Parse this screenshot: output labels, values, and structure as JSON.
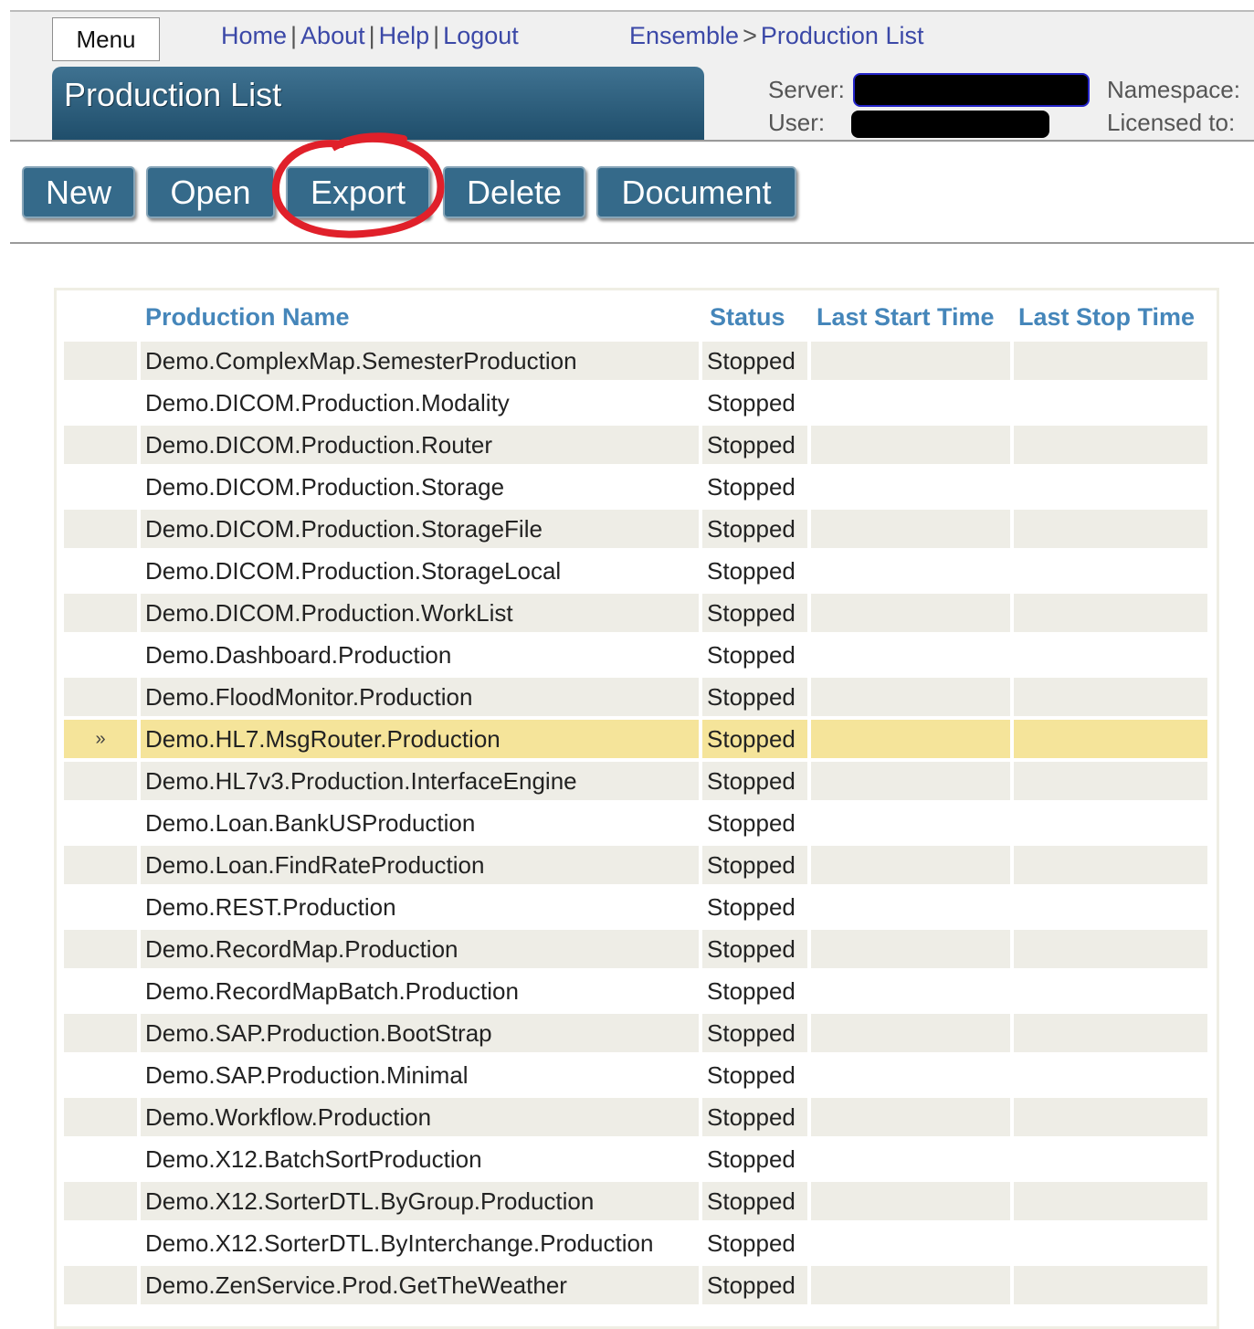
{
  "header": {
    "menu_label": "Menu",
    "links": [
      "Home",
      "About",
      "Help",
      "Logout"
    ],
    "breadcrumb": [
      "Ensemble",
      "Production List"
    ],
    "breadcrumb_sep": ">",
    "page_title": "Production List",
    "server_label": "Server:",
    "user_label": "User:",
    "namespace_label": "Namespace:",
    "licensed_label": "Licensed to:"
  },
  "toolbar": {
    "new": "New",
    "open": "Open",
    "export": "Export",
    "delete": "Delete",
    "document": "Document"
  },
  "table": {
    "columns": [
      "Production Name",
      "Status",
      "Last Start Time",
      "Last Stop Time"
    ],
    "selected_marker": "»",
    "rows": [
      {
        "name": "Demo.ComplexMap.SemesterProduction",
        "status": "Stopped"
      },
      {
        "name": "Demo.DICOM.Production.Modality",
        "status": "Stopped"
      },
      {
        "name": "Demo.DICOM.Production.Router",
        "status": "Stopped"
      },
      {
        "name": "Demo.DICOM.Production.Storage",
        "status": "Stopped"
      },
      {
        "name": "Demo.DICOM.Production.StorageFile",
        "status": "Stopped"
      },
      {
        "name": "Demo.DICOM.Production.StorageLocal",
        "status": "Stopped"
      },
      {
        "name": "Demo.DICOM.Production.WorkList",
        "status": "Stopped"
      },
      {
        "name": "Demo.Dashboard.Production",
        "status": "Stopped"
      },
      {
        "name": "Demo.FloodMonitor.Production",
        "status": "Stopped"
      },
      {
        "name": "Demo.HL7.MsgRouter.Production",
        "status": "Stopped",
        "selected": true
      },
      {
        "name": "Demo.HL7v3.Production.InterfaceEngine",
        "status": "Stopped"
      },
      {
        "name": "Demo.Loan.BankUSProduction",
        "status": "Stopped"
      },
      {
        "name": "Demo.Loan.FindRateProduction",
        "status": "Stopped"
      },
      {
        "name": "Demo.REST.Production",
        "status": "Stopped"
      },
      {
        "name": "Demo.RecordMap.Production",
        "status": "Stopped"
      },
      {
        "name": "Demo.RecordMapBatch.Production",
        "status": "Stopped"
      },
      {
        "name": "Demo.SAP.Production.BootStrap",
        "status": "Stopped"
      },
      {
        "name": "Demo.SAP.Production.Minimal",
        "status": "Stopped"
      },
      {
        "name": "Demo.Workflow.Production",
        "status": "Stopped"
      },
      {
        "name": "Demo.X12.BatchSortProduction",
        "status": "Stopped"
      },
      {
        "name": "Demo.X12.SorterDTL.ByGroup.Production",
        "status": "Stopped"
      },
      {
        "name": "Demo.X12.SorterDTL.ByInterchange.Production",
        "status": "Stopped"
      },
      {
        "name": "Demo.ZenService.Prod.GetTheWeather",
        "status": "Stopped"
      }
    ]
  },
  "colors": {
    "accent": "#356a8a",
    "link": "#3b48a7",
    "column_header": "#4586ba",
    "row_alt": "#eeede6",
    "row_selected": "#f5e49a",
    "annotation": "#e0202a"
  }
}
